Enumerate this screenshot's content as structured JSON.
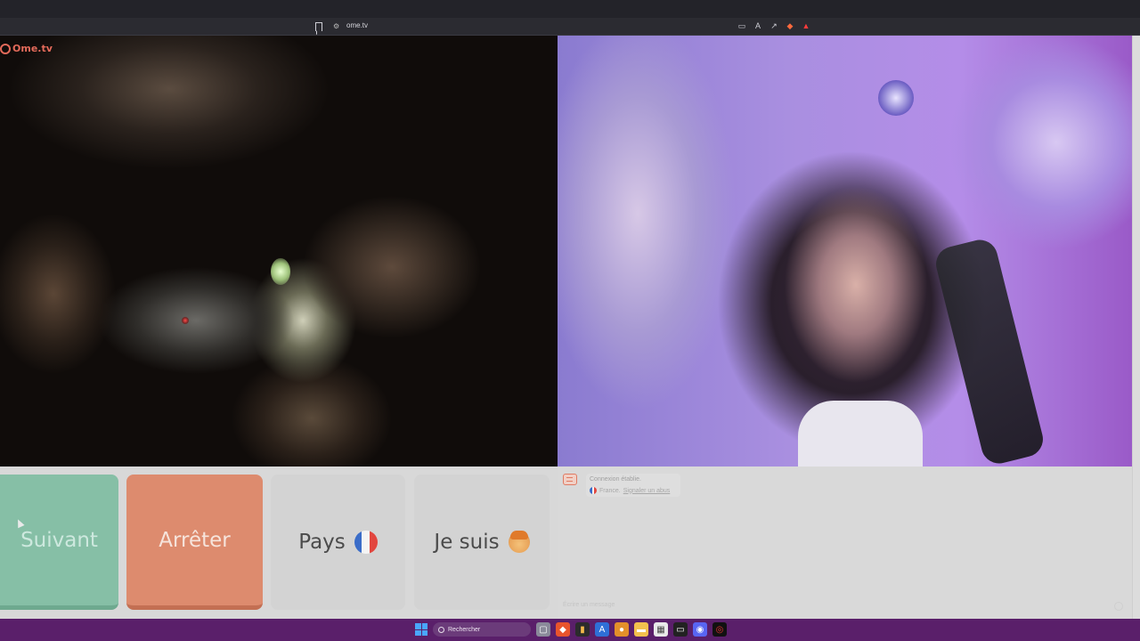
{
  "browser": {
    "url": "ome.tv"
  },
  "site": {
    "logo_text": "Ome.tv"
  },
  "controls": {
    "next_label": "Suivant",
    "stop_label": "Arrêter",
    "country_label": "Pays",
    "gender_label": "Je suis"
  },
  "chat": {
    "status_message": "Connexion établie.",
    "country": "France.",
    "report_link": "Signaler un abus",
    "input_placeholder": "Écrire un message"
  },
  "taskbar": {
    "search_placeholder": "Rechercher"
  },
  "colors": {
    "next_button": "#86bfa6",
    "stop_button": "#dd8b6e",
    "logo": "#e36a5a",
    "taskbar": "#5a1f6a"
  },
  "icons": [
    "bookmark-icon",
    "site-settings-icon",
    "chat-icon",
    "france-flag-icon",
    "user-avatar-icon",
    "windows-icon",
    "search-icon"
  ]
}
